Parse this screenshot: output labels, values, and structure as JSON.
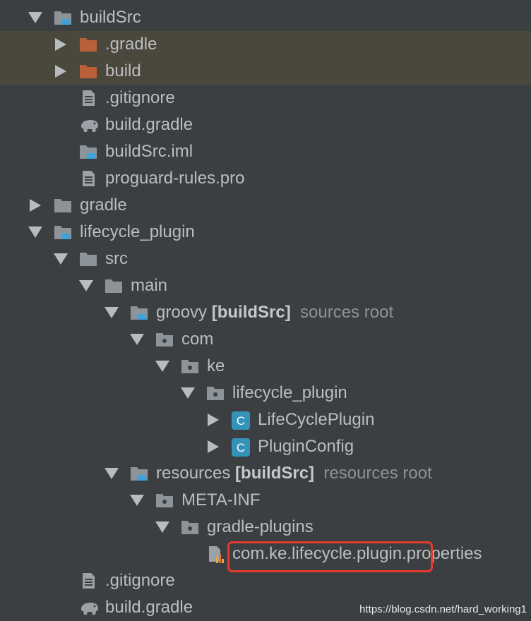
{
  "tree": [
    {
      "label": "buildSrc",
      "level": 1,
      "arrow": "down",
      "icon": "module-folder-icon"
    },
    {
      "label": ".gradle",
      "level": 2,
      "arrow": "right",
      "icon": "excluded-folder-icon",
      "highlight": true
    },
    {
      "label": "build",
      "level": 2,
      "arrow": "right",
      "icon": "excluded-folder-icon",
      "highlight": true
    },
    {
      "label": ".gitignore",
      "level": 2,
      "icon": "text-file-icon"
    },
    {
      "label": "build.gradle",
      "level": 2,
      "icon": "gradle-elephant-icon"
    },
    {
      "label": "buildSrc.iml",
      "level": 2,
      "icon": "module-folder-icon"
    },
    {
      "label": "proguard-rules.pro",
      "level": 2,
      "icon": "text-file-icon"
    },
    {
      "label": "gradle",
      "level": 1,
      "arrow": "right",
      "icon": "folder-icon"
    },
    {
      "label": "lifecycle_plugin",
      "level": 1,
      "arrow": "down",
      "icon": "module-folder-icon"
    },
    {
      "label": "src",
      "level": 2,
      "arrow": "down",
      "icon": "folder-icon"
    },
    {
      "label": "main",
      "level": 3,
      "arrow": "down",
      "icon": "folder-icon"
    },
    {
      "label": "groovy",
      "bold": "[buildSrc]",
      "hint": "sources root",
      "level": 4,
      "arrow": "down",
      "icon": "module-folder-icon"
    },
    {
      "label": "com",
      "level": 5,
      "arrow": "down",
      "icon": "package-icon"
    },
    {
      "label": "ke",
      "level": 6,
      "arrow": "down",
      "icon": "package-icon"
    },
    {
      "label": "lifecycle_plugin",
      "level": 7,
      "arrow": "down",
      "icon": "package-icon"
    },
    {
      "label": "LifeCyclePlugin",
      "level": 8,
      "arrow": "right",
      "icon": "class-icon"
    },
    {
      "label": "PluginConfig",
      "level": 8,
      "arrow": "right",
      "icon": "class-icon"
    },
    {
      "label": "resources",
      "bold": "[buildSrc]",
      "hint": "resources root",
      "level": 4,
      "arrow": "down",
      "icon": "module-folder-icon"
    },
    {
      "label": "META-INF",
      "level": 5,
      "arrow": "down",
      "icon": "package-icon"
    },
    {
      "label": "gradle-plugins",
      "level": 6,
      "arrow": "down",
      "icon": "package-icon"
    },
    {
      "label": "com.ke.lifecycle.plugin.properties",
      "level": 7,
      "icon": "properties-file-icon"
    },
    {
      "label": ".gitignore",
      "level": 2,
      "icon": "text-file-icon"
    },
    {
      "label": "build.gradle",
      "level": 2,
      "icon": "gradle-elephant-icon"
    }
  ],
  "watermark": "https://blog.csdn.net/hard_working1",
  "colors": {
    "background": "#3c3f41",
    "highlight": "#4a473d",
    "text": "#bbbdbf",
    "hint": "#8e9295",
    "folder": "#8c9499",
    "excluded_folder": "#b8603a",
    "class": "#3592b8",
    "accent_blue": "#40a2d8",
    "annotation_box": "#e53b2f"
  }
}
